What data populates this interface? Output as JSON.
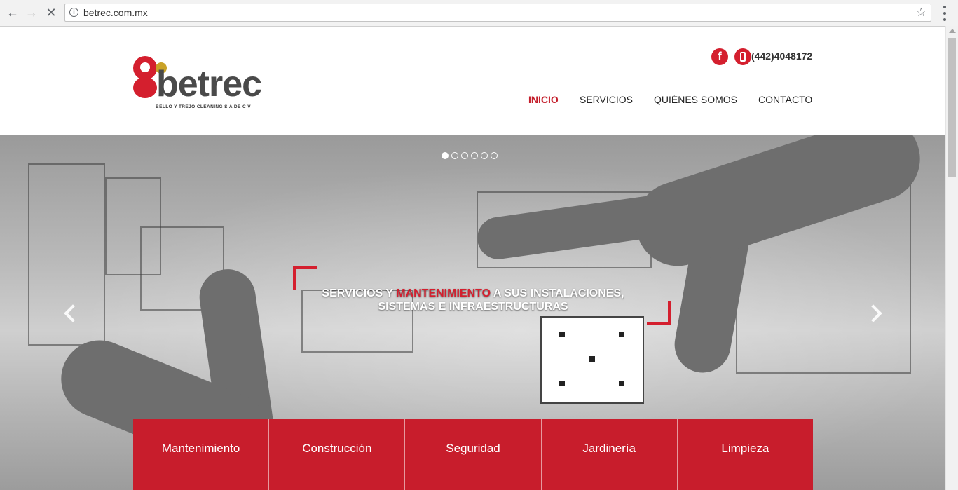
{
  "browser": {
    "url": "betrec.com.mx"
  },
  "header": {
    "logo_text": "betrec",
    "logo_sub": "BELLO Y TREJO CLEANING S A  DE C V",
    "facebook_glyph": "f",
    "phone": "(442)4048172"
  },
  "nav": {
    "items": [
      {
        "label": "INICIO",
        "active": true
      },
      {
        "label": "SERVICIOS",
        "active": false
      },
      {
        "label": "QUIÉNES SOMOS",
        "active": false
      },
      {
        "label": "CONTACTO",
        "active": false
      }
    ]
  },
  "hero": {
    "tagline_pre": "SERVICIOS Y ",
    "tagline_highlight": "MANTENIMIENTO",
    "tagline_post": " A SUS INSTALACIONES,",
    "tagline_line2": "SISTEMAS E INFRAESTRUCTURAS",
    "slides_total": 6,
    "slide_active": 1
  },
  "services": [
    "Mantenimiento",
    "Construcción",
    "Seguridad",
    "Jardinería",
    "Limpieza"
  ],
  "colors": {
    "brand_red": "#c81d2c",
    "accent_gold": "#c9a227",
    "logo_gray": "#4a4a4a"
  },
  "icons": [
    "back-arrow-icon",
    "forward-arrow-icon",
    "stop-icon",
    "info-icon",
    "star-icon",
    "menu-dots-icon",
    "facebook-icon",
    "phone-icon",
    "chevron-left-icon",
    "chevron-right-icon"
  ]
}
